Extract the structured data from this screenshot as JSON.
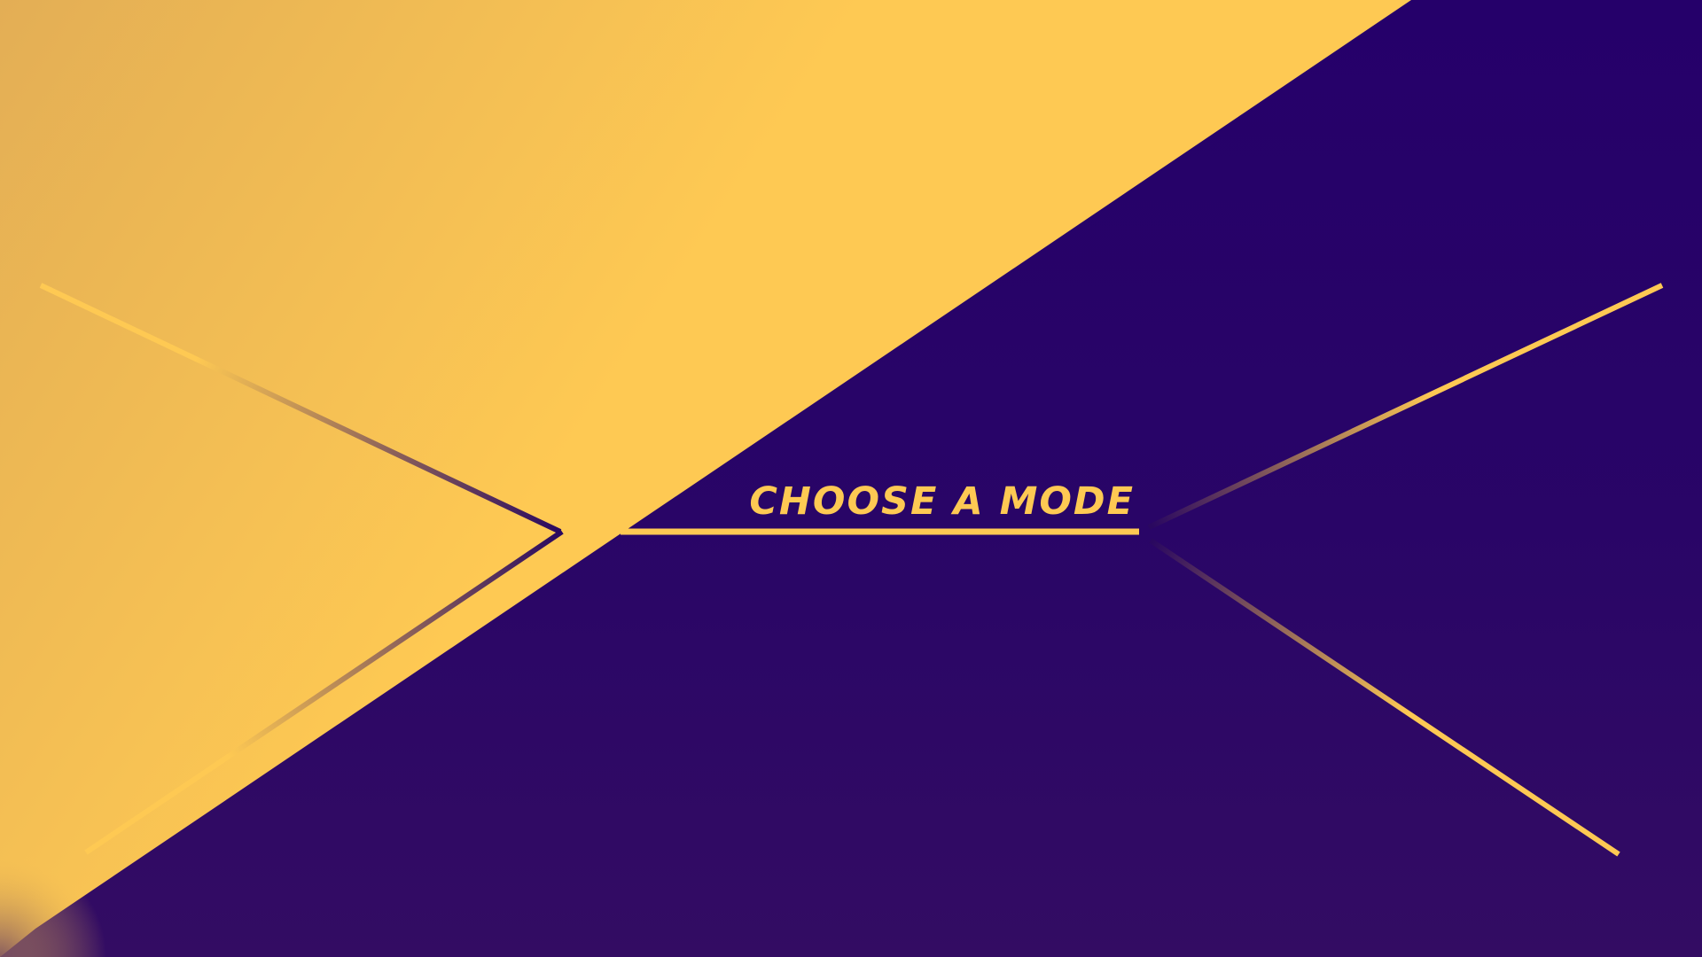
{
  "menu": {
    "title": "CHOOSE A MODE"
  },
  "colors": {
    "accent_yellow": "#FEC953",
    "deep_yellow": "#E3AE55",
    "indigo": "#250065",
    "indigo_deep": "#330C63",
    "line_dark": "#2A0860"
  },
  "decor": {
    "top_panel": "yellow-diagonal-panel",
    "bottom_panel": "indigo-diagonal-panel",
    "lines": [
      "left-chevron-lines",
      "right-chevron-lines",
      "title-underline"
    ]
  }
}
